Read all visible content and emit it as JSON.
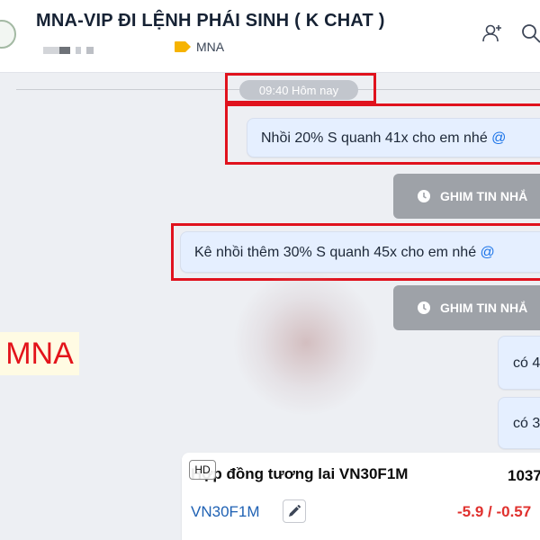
{
  "header": {
    "title": "MNA-VIP ĐI LỆNH PHÁI SINH ( K CHAT )",
    "tag_label": "MNA",
    "tag_color": "#f6b300",
    "icons": [
      "add-member-icon",
      "search-icon"
    ]
  },
  "chat": {
    "time_divider": "09:40 Hôm nay",
    "messages": [
      {
        "text": "Nhồi 20% S quanh 41x cho em nhé ",
        "mention": "@"
      },
      {
        "pin_label": "GHIM TIN NHẮ"
      },
      {
        "text": "Kê nhồi thêm 30% S quanh 45x cho em nhé ",
        "mention": "@"
      },
      {
        "pin_label": "GHIM TIN NHẮ"
      },
      {
        "text": "có 4"
      },
      {
        "text": "có 3"
      }
    ],
    "watermark": "MNA",
    "highlight_color": "#e0121d"
  },
  "card": {
    "badge": "HD",
    "title": "Hợp đồng tương lai VN30F1M",
    "price": "1037",
    "symbol": "VN30F1M",
    "change": "-5.9 / -0.57",
    "change_color": "#e0312e"
  }
}
